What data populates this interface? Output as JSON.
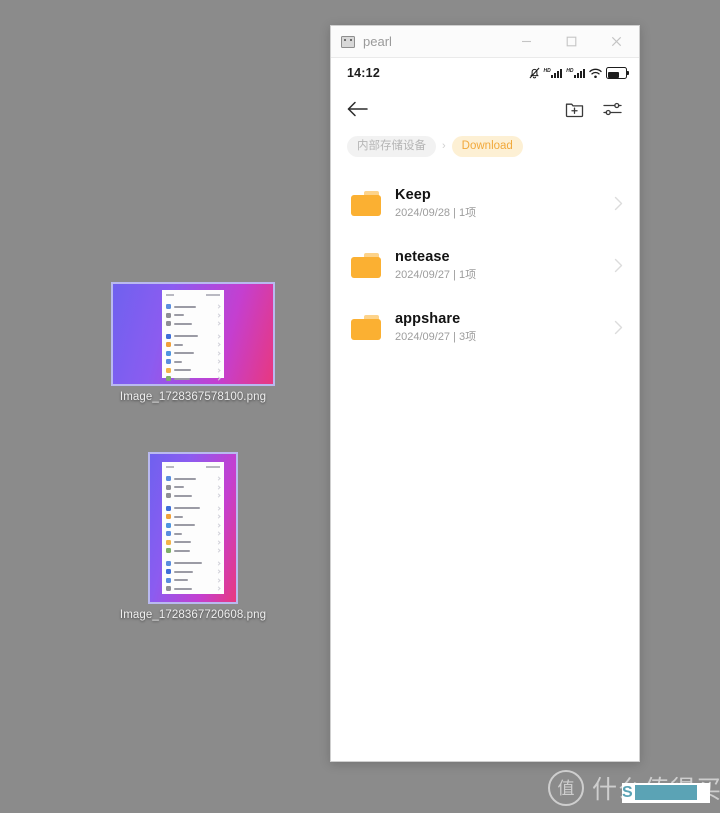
{
  "desktop": {
    "background_color": "#8b8b8b",
    "icons": [
      {
        "filename": "Image_1728367578100.png",
        "orientation": "landscape",
        "thumbnail_desc": "purple-to-pink gradient screenshot with white settings list panel"
      },
      {
        "filename": "Image_1728367720608.png",
        "orientation": "portrait",
        "thumbnail_desc": "purple-to-pink gradient screenshot with white settings list panel"
      }
    ]
  },
  "window": {
    "title": "pearl",
    "app_icon": "monitor-icon",
    "controls": {
      "minimize": "minimize-icon",
      "maximize": "maximize-icon",
      "close": "close-icon"
    }
  },
  "phone": {
    "status_bar": {
      "clock": "14:12",
      "icons": [
        "mute-bell-icon",
        "signal-hd-1-icon",
        "signal-hd-2-icon",
        "wifi-icon",
        "battery-charging-icon"
      ]
    },
    "toolbar": {
      "back": "back-arrow-icon",
      "new_folder": "new-folder-icon",
      "settings": "sliders-icon"
    },
    "breadcrumb": {
      "root_label": "内部存储设备",
      "separator": "›",
      "current_label": "Download",
      "active_color": "#f1a93c",
      "active_bg": "#fdf0d4",
      "muted_bg": "#f2f2f2"
    },
    "files": [
      {
        "name": "Keep",
        "date": "2024/09/28",
        "divider": "|",
        "count": "1项",
        "icon": "folder-icon",
        "chevron": "chevron-right-icon"
      },
      {
        "name": "netease",
        "date": "2024/09/27",
        "divider": "|",
        "count": "1项",
        "icon": "folder-icon",
        "chevron": "chevron-right-icon"
      },
      {
        "name": "appshare",
        "date": "2024/09/27",
        "divider": "|",
        "count": "3项",
        "icon": "folder-icon",
        "chevron": "chevron-right-icon"
      }
    ],
    "folder_color": "#fbb032"
  },
  "watermark": {
    "logo_glyph": "值",
    "text": "什么值得买",
    "redacted_text": "S                T",
    "highlight_color": "#5ba3b5"
  }
}
